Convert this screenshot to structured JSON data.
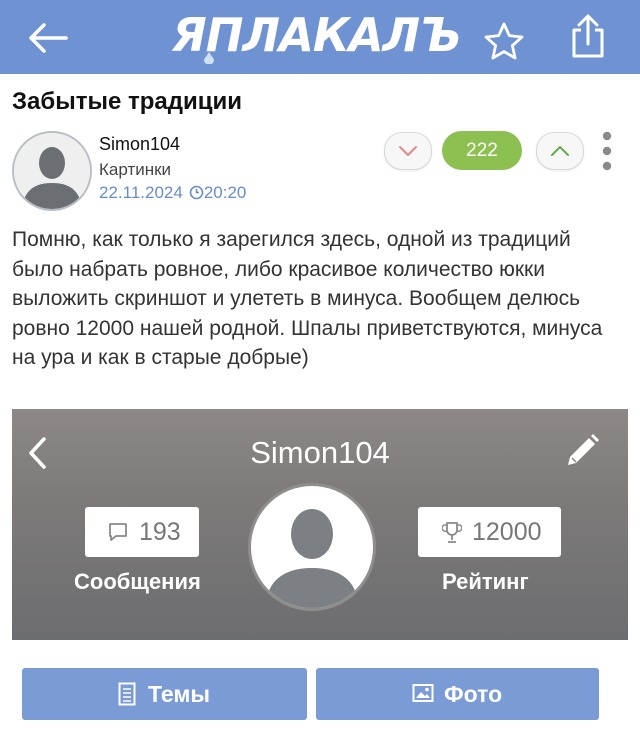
{
  "header": {
    "logo_text": "ЯПЛАКАЛЪ",
    "back_icon": "back-arrow-icon",
    "star_icon": "star-icon",
    "share_icon": "share-icon",
    "bar_color": "#6f93d2"
  },
  "post": {
    "title": "Забытые традиции",
    "author": "Simon104",
    "category": "Картинки",
    "date": "22.11.2024",
    "time": "20:20",
    "score": "222",
    "score_color": "#8cc152",
    "body": "Помню, как только я зарегился здесь, одной из традиций было набрать ровное, либо красивое количество юкки выложить скриншот и улететь в минуса. Вообщем делюсь ровно 12000 нашей родной. Шпалы приветствуются, минуса на ура и как в старые добрые)"
  },
  "embedded_profile": {
    "name": "Simon104",
    "messages_count": "193",
    "messages_label": "Сообщения",
    "rating_value": "12000",
    "rating_label": "Рейтинг"
  },
  "tabs": {
    "themes_label": "Темы",
    "photo_label": "Фото"
  }
}
